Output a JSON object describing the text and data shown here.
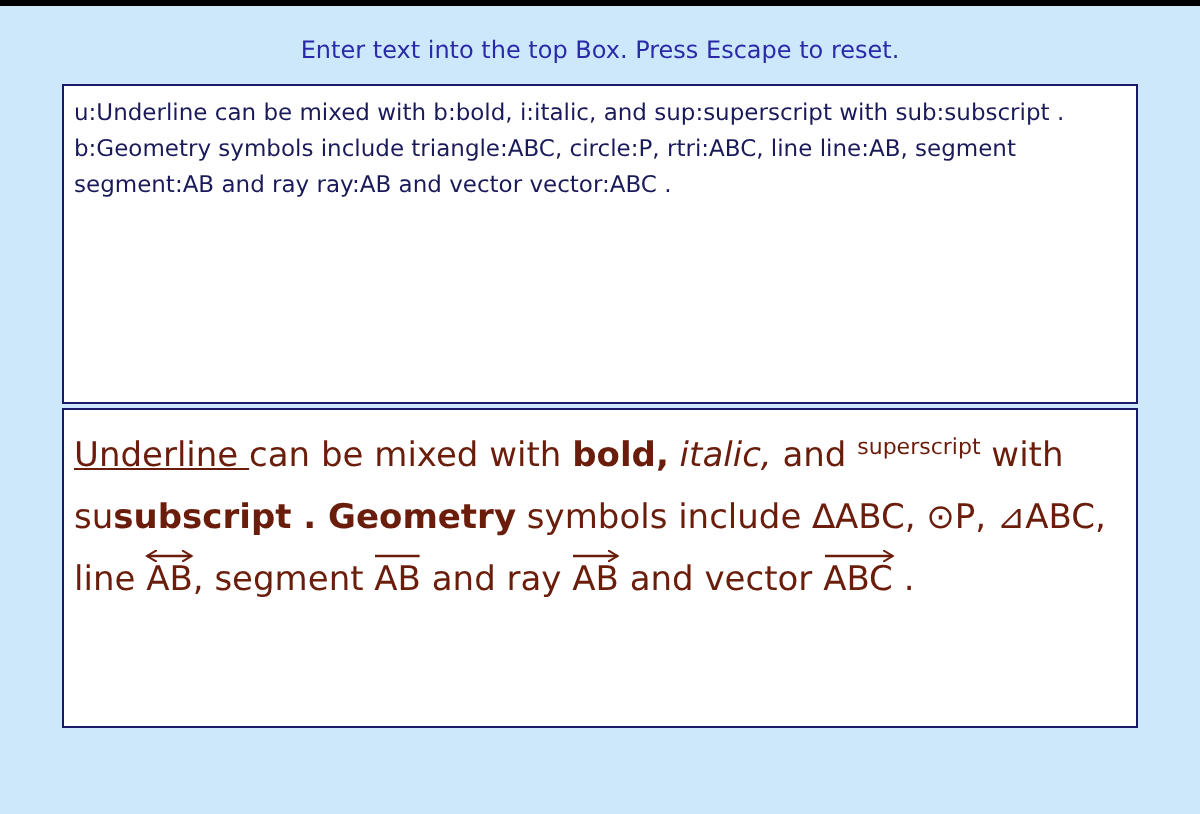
{
  "instruction": "Enter text into the top Box. Press Escape to reset.",
  "input": {
    "value": "u:Underline can be mixed with b:bold, i:italic, and sup:superscript with sub:subscript .\nb:Geometry symbols include triangle:ABC, circle:P, rtri:ABC, line line:AB, segment segment:AB and ray ray:AB and vector vector:ABC ."
  },
  "output": {
    "segments": [
      {
        "kind": "underline",
        "text": "Underline "
      },
      {
        "kind": "plain",
        "text": "can be mixed with "
      },
      {
        "kind": "bold",
        "text": "bold,"
      },
      {
        "kind": "italic",
        "text": " italic,"
      },
      {
        "kind": "plain",
        "text": " and "
      },
      {
        "kind": "sup",
        "text": "superscript"
      },
      {
        "kind": "plain",
        "text": " with su"
      },
      {
        "kind": "bold",
        "text": "subscript . Geometry"
      },
      {
        "kind": "plain",
        "text": " symbols include ∆ABC, ⊙P, ⊿ABC, line "
      },
      {
        "kind": "line",
        "text": "AB"
      },
      {
        "kind": "plain",
        "text": ", segment "
      },
      {
        "kind": "segment",
        "text": "AB"
      },
      {
        "kind": "plain",
        "text": " and ray "
      },
      {
        "kind": "ray",
        "text": "AB"
      },
      {
        "kind": "plain",
        "text": " and vector "
      },
      {
        "kind": "vector",
        "text": "ABC"
      },
      {
        "kind": "plain",
        "text": " ."
      }
    ]
  }
}
